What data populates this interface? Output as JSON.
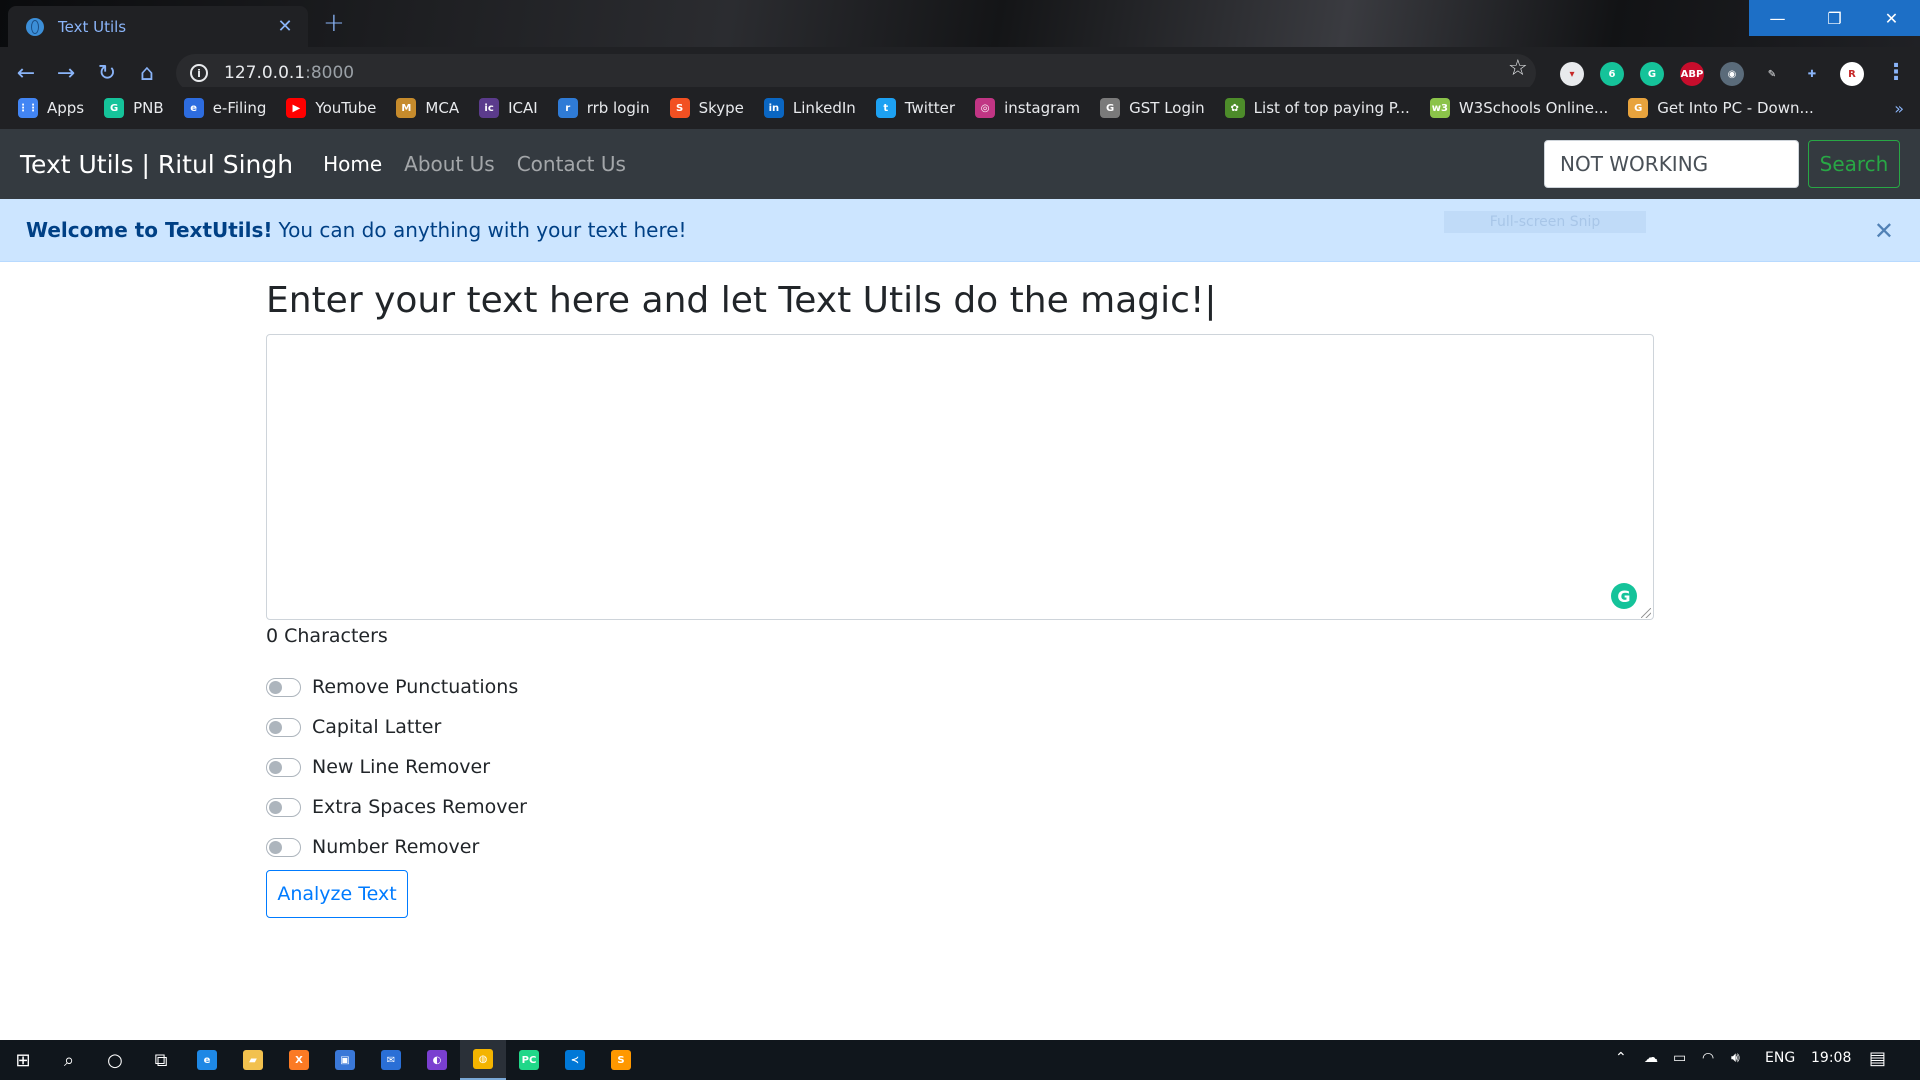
{
  "browser": {
    "tab_title": "Text Utils",
    "tab_close": "✕",
    "new_tab": "+",
    "url_host": "127.0.0.1",
    "url_port": ":8000",
    "info_glyph": "i",
    "star_glyph": "☆",
    "menu_glyph": "⋮",
    "bookmarks_more": "»",
    "window": {
      "minimize": "—",
      "restore": "❐",
      "close": "✕"
    },
    "extensions": [
      {
        "icon": "pocket-icon",
        "label": "▾",
        "color": "#e8eaed",
        "fg": "#c62828"
      },
      {
        "icon": "grammarly-badge-icon",
        "label": "6",
        "color": "#15c39a",
        "fg": "#fff"
      },
      {
        "icon": "grammarly-icon",
        "label": "G",
        "color": "#15c39a",
        "fg": "#fff"
      },
      {
        "icon": "adblock-plus-icon",
        "label": "ABP",
        "color": "#c70d2c",
        "fg": "#fff"
      },
      {
        "icon": "mask-icon",
        "label": "◉",
        "color": "#5a6b7a",
        "fg": "#fff"
      },
      {
        "icon": "pen-icon",
        "label": "✎",
        "color": "transparent",
        "fg": "#e8eaed"
      },
      {
        "icon": "puzzle-icon",
        "label": "✚",
        "color": "transparent",
        "fg": "#8ab4f8"
      },
      {
        "icon": "profile-avatar-icon",
        "label": "R",
        "color": "#ffffff",
        "fg": "#c62828"
      }
    ]
  },
  "bookmarks": [
    {
      "label": "Apps",
      "icon": "apps-grid-icon",
      "glyph": "⋮⋮",
      "color": "#4285f4"
    },
    {
      "label": "PNB",
      "icon": "pnb-icon",
      "glyph": "G",
      "color": "#15c39a"
    },
    {
      "label": "e-Filing",
      "icon": "efiling-icon",
      "glyph": "e",
      "color": "#2d6cdf"
    },
    {
      "label": "YouTube",
      "icon": "youtube-icon",
      "glyph": "▶",
      "color": "#ff0000"
    },
    {
      "label": "MCA",
      "icon": "mca-icon",
      "glyph": "M",
      "color": "#c68b2c"
    },
    {
      "label": "ICAI",
      "icon": "icai-icon",
      "glyph": "ic",
      "color": "#5b3b8c"
    },
    {
      "label": "rrb login",
      "icon": "rrb-icon",
      "glyph": "r",
      "color": "#2f7bd6"
    },
    {
      "label": "Skype",
      "icon": "skype-icon",
      "glyph": "S",
      "color": "#f25022"
    },
    {
      "label": "LinkedIn",
      "icon": "linkedin-icon",
      "glyph": "in",
      "color": "#0a66c2"
    },
    {
      "label": "Twitter",
      "icon": "twitter-icon",
      "glyph": "t",
      "color": "#1da1f2"
    },
    {
      "label": "instagram",
      "icon": "instagram-icon",
      "glyph": "◎",
      "color": "#c13584"
    },
    {
      "label": "GST Login",
      "icon": "gst-icon",
      "glyph": "G",
      "color": "#7a7a7a"
    },
    {
      "label": "List of top paying P...",
      "icon": "leaf-icon",
      "glyph": "✿",
      "color": "#4d8c2a"
    },
    {
      "label": "W3Schools Online...",
      "icon": "w3schools-icon",
      "glyph": "w3",
      "color": "#8bc34a"
    },
    {
      "label": "Get Into PC - Down...",
      "icon": "getintopc-icon",
      "glyph": "G",
      "color": "#e8a33d"
    }
  ],
  "site": {
    "brand": "Text Utils | Ritul Singh",
    "nav": [
      "Home",
      "About Us",
      "Contact Us"
    ],
    "search_value": "NOT WORKING",
    "search_button": "Search",
    "alert_strong": "Welcome to TextUtils!",
    "alert_text": "You can do anything with your text here!",
    "alert_close": "✕",
    "snip_label": "Full-screen Snip",
    "heading": "Enter your text here and let Text Utils do the magic!|",
    "char_count": "0 Characters",
    "grammarly": "G",
    "options": [
      "Remove Punctuations",
      "Capital Latter",
      "New Line Remover",
      "Extra Spaces Remover",
      "Number Remover"
    ],
    "options_checked": [
      false,
      false,
      false,
      false,
      false
    ],
    "analyze_button": "Analyze Text"
  },
  "taskbar": {
    "lang": "ENG",
    "time": "19:08",
    "apps": [
      {
        "icon": "windows-start-icon",
        "glyph": "⊞",
        "color": "transparent"
      },
      {
        "icon": "search-icon",
        "glyph": "⌕",
        "color": "transparent"
      },
      {
        "icon": "cortana-icon",
        "glyph": "○",
        "color": "transparent"
      },
      {
        "icon": "task-view-icon",
        "glyph": "⧉",
        "color": "transparent"
      },
      {
        "icon": "edge-icon",
        "glyph": "e",
        "color": "#1e88e5"
      },
      {
        "icon": "file-explorer-icon",
        "glyph": "▰",
        "color": "#f2c14e"
      },
      {
        "icon": "xampp-icon",
        "glyph": "X",
        "color": "#fb7a24"
      },
      {
        "icon": "store-icon",
        "glyph": "▣",
        "color": "#3a78d8"
      },
      {
        "icon": "mail-icon",
        "glyph": "✉",
        "color": "#2a6fd6"
      },
      {
        "icon": "media-player-icon",
        "glyph": "◐",
        "color": "#7a3fd0"
      },
      {
        "icon": "chrome-icon",
        "glyph": "◍",
        "color": "#f4b400"
      },
      {
        "icon": "pycharm-icon",
        "glyph": "PC",
        "color": "#21d789"
      },
      {
        "icon": "vscode-icon",
        "glyph": "≺",
        "color": "#0078d7"
      },
      {
        "icon": "sublime-icon",
        "glyph": "S",
        "color": "#ff9800"
      }
    ],
    "tray": [
      {
        "icon": "tray-chevron-icon",
        "glyph": "⌃"
      },
      {
        "icon": "onedrive-icon",
        "glyph": "☁"
      },
      {
        "icon": "battery-icon",
        "glyph": "▭"
      },
      {
        "icon": "wifi-icon",
        "glyph": "◠"
      },
      {
        "icon": "volume-icon",
        "glyph": "🔊︎"
      }
    ],
    "notifications_glyph": "▤"
  },
  "colors": {
    "navbar_bg": "#343a40",
    "alert_bg": "#cce5ff",
    "alert_text": "#004085",
    "success": "#28a745",
    "primary": "#007bff"
  }
}
